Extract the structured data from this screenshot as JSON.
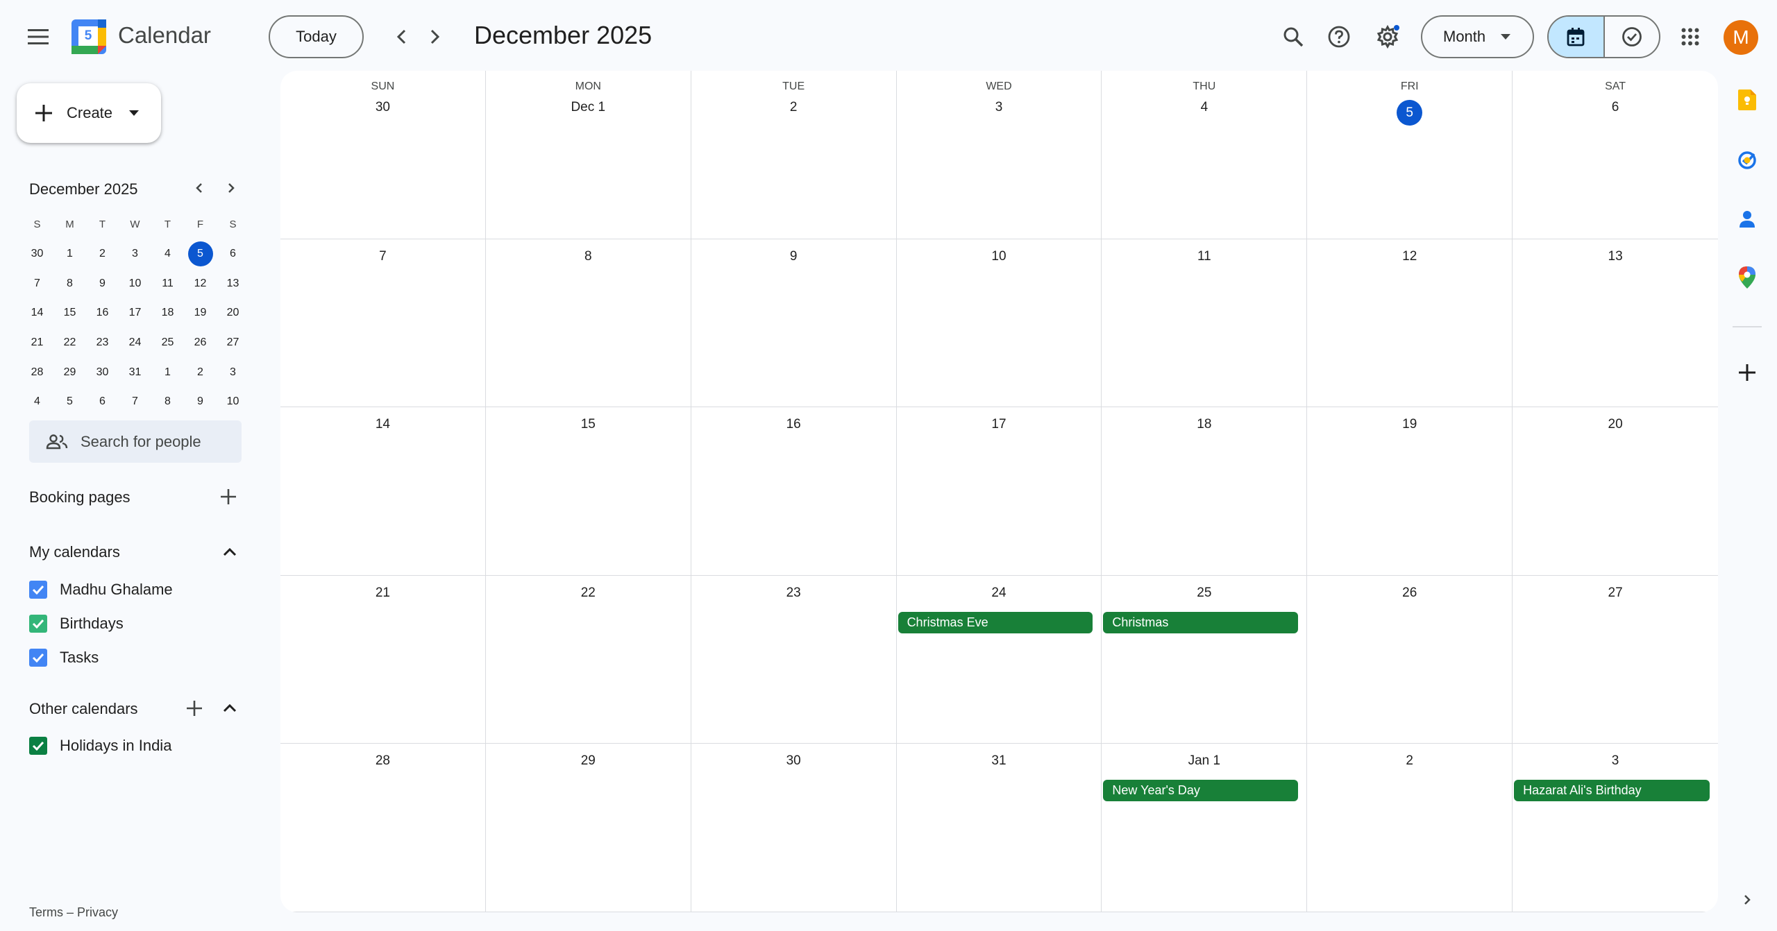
{
  "app": {
    "name": "Calendar",
    "logo_day": "5"
  },
  "header": {
    "today_label": "Today",
    "title": "December 2025",
    "view_label": "Month",
    "avatar_letter": "M"
  },
  "sidebar": {
    "create_label": "Create",
    "mini": {
      "title": "December 2025",
      "weekdays": [
        "S",
        "M",
        "T",
        "W",
        "T",
        "F",
        "S"
      ],
      "days": [
        "30",
        "1",
        "2",
        "3",
        "4",
        "5",
        "6",
        "7",
        "8",
        "9",
        "10",
        "11",
        "12",
        "13",
        "14",
        "15",
        "16",
        "17",
        "18",
        "19",
        "20",
        "21",
        "22",
        "23",
        "24",
        "25",
        "26",
        "27",
        "28",
        "29",
        "30",
        "31",
        "1",
        "2",
        "3",
        "4",
        "5",
        "6",
        "7",
        "8",
        "9",
        "10"
      ],
      "selected_index": 5
    },
    "search_people_placeholder": "Search for people",
    "booking_pages_label": "Booking pages",
    "my_calendars_label": "My calendars",
    "my_calendars": [
      {
        "name": "Madhu Ghalame",
        "color": "#4285f4"
      },
      {
        "name": "Birthdays",
        "color": "#33b679"
      },
      {
        "name": "Tasks",
        "color": "#4285f4"
      }
    ],
    "other_calendars_label": "Other calendars",
    "other_calendars": [
      {
        "name": "Holidays in India",
        "color": "#0b8043"
      }
    ],
    "footer": {
      "terms": "Terms",
      "sep": "–",
      "privacy": "Privacy"
    }
  },
  "grid": {
    "weekdays": [
      "SUN",
      "MON",
      "TUE",
      "WED",
      "THU",
      "FRI",
      "SAT"
    ],
    "days": [
      "30",
      "Dec 1",
      "2",
      "3",
      "4",
      "5",
      "6",
      "7",
      "8",
      "9",
      "10",
      "11",
      "12",
      "13",
      "14",
      "15",
      "16",
      "17",
      "18",
      "19",
      "20",
      "21",
      "22",
      "23",
      "24",
      "25",
      "26",
      "27",
      "28",
      "29",
      "30",
      "31",
      "Jan 1",
      "2",
      "3"
    ],
    "today_index": 5,
    "events": [
      {
        "title": "Christmas Eve",
        "day_index": 24,
        "color": "#188038"
      },
      {
        "title": "Christmas",
        "day_index": 25,
        "color": "#188038"
      },
      {
        "title": "New Year's Day",
        "day_index": 32,
        "color": "#188038"
      },
      {
        "title": "Hazarat Ali's Birthday",
        "day_index": 34,
        "color": "#188038"
      }
    ]
  },
  "icons": {
    "menu": "menu-icon",
    "search": "search-icon",
    "help": "help-icon",
    "settings": "settings-icon",
    "apps": "apps-grid-icon",
    "calendar_view": "calendar-icon",
    "tasks_view": "check-circle-icon",
    "keep": "keep-icon",
    "tasks": "tasks-icon",
    "contacts": "contacts-icon",
    "maps": "maps-icon"
  }
}
